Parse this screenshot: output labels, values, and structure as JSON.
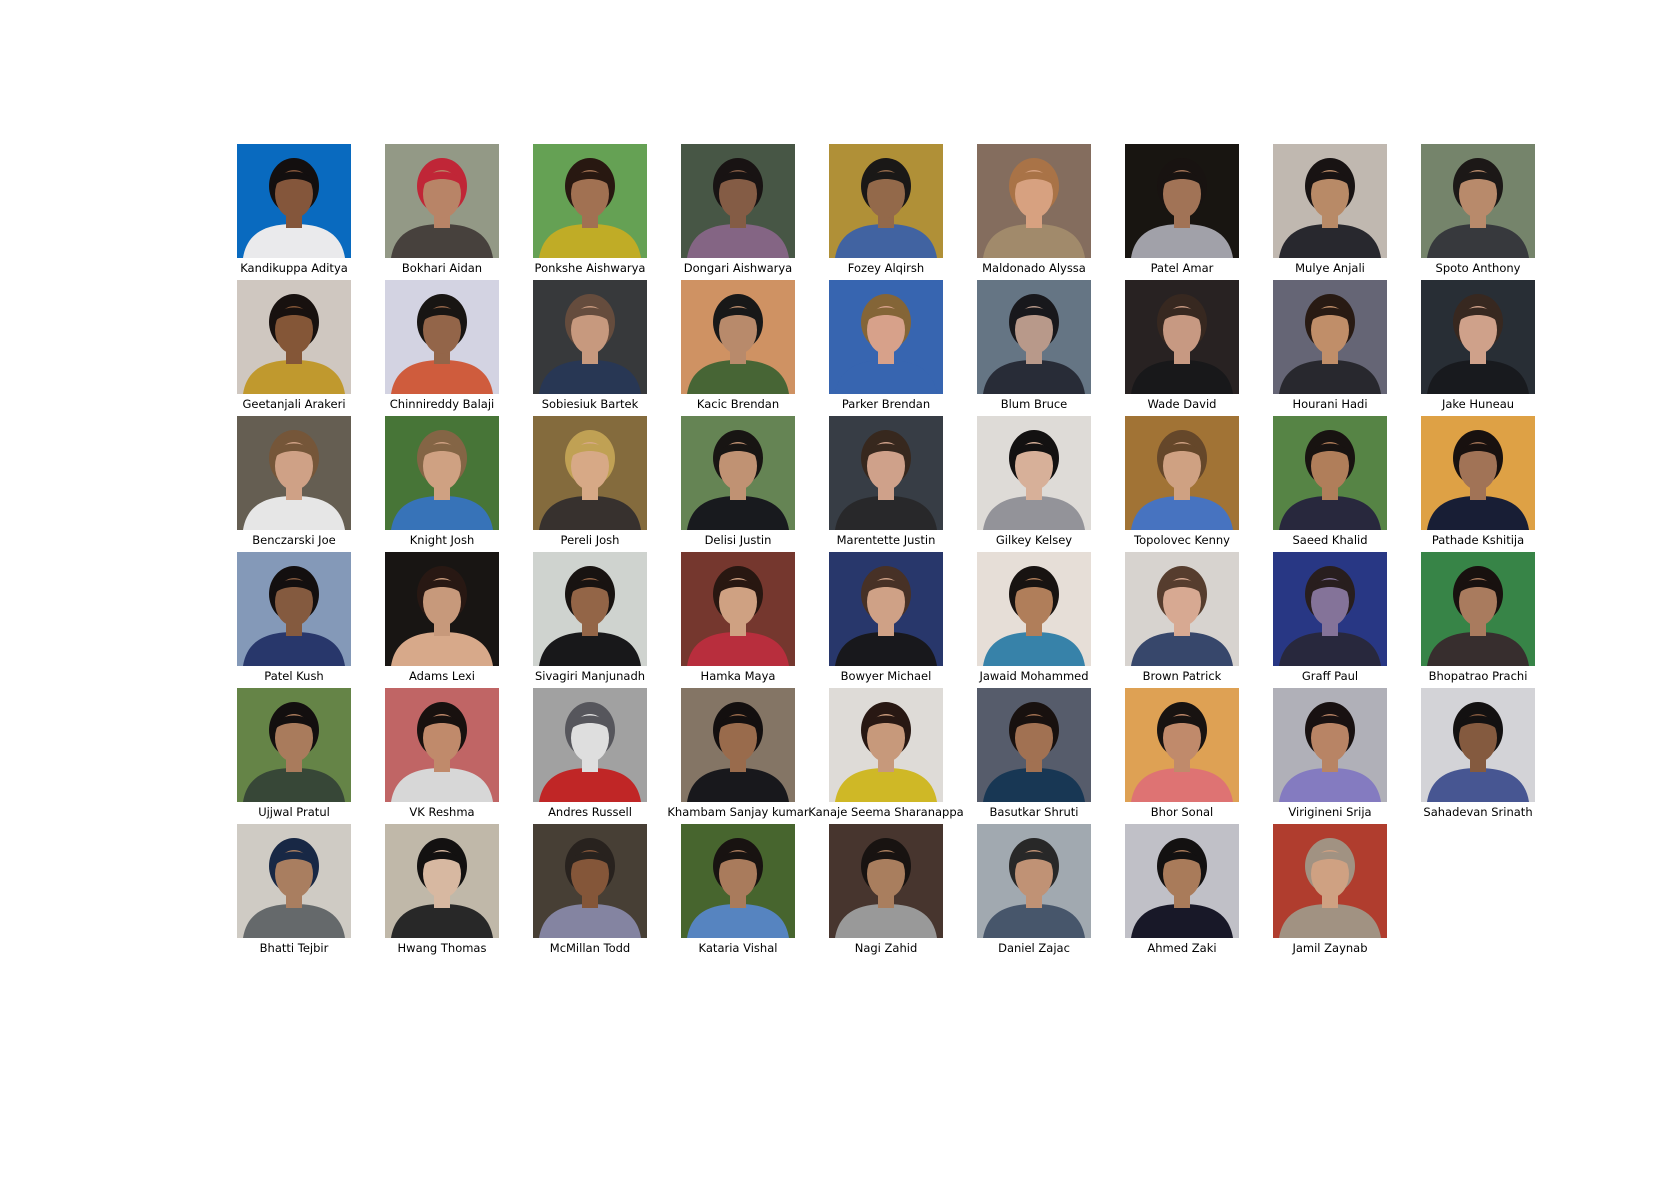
{
  "people": [
    {
      "name": "Kandikuppa Aditya",
      "bg": "#0a6fc7",
      "hair": "#141010",
      "skin": "#8a5a3e",
      "shirt": "#f4f4f6"
    },
    {
      "name": "Bokhari Aidan",
      "bg": "#9aa08c",
      "hair": "#c8283a",
      "skin": "#c08a6c",
      "shirt": "#4a4440"
    },
    {
      "name": "Ponkshe Aishwarya",
      "bg": "#6aa858",
      "hair": "#2a1a12",
      "skin": "#a87656",
      "shirt": "#c8b428"
    },
    {
      "name": "Dongari Aishwarya",
      "bg": "#4a5a48",
      "hair": "#1a1414",
      "skin": "#8a6048",
      "shirt": "#8a6a8a"
    },
    {
      "name": "Fozey Alqirsh",
      "bg": "#b8963a",
      "hair": "#1c1a18",
      "skin": "#9a6e4e",
      "shirt": "#4468a8"
    },
    {
      "name": "Maldonado Alyssa",
      "bg": "#8a7262",
      "hair": "#b0784a",
      "skin": "#e0a886",
      "shirt": "#a89070"
    },
    {
      "name": "Patel Amar",
      "bg": "#1a1612",
      "hair": "#1a1412",
      "skin": "#a8785a",
      "shirt": "#a8a8b0"
    },
    {
      "name": "Mulye Anjali",
      "bg": "#c8c0b8",
      "hair": "#1a1414",
      "skin": "#c0906c",
      "shirt": "#2a2a30"
    },
    {
      "name": "Spoto Anthony",
      "bg": "#7a8a70",
      "hair": "#1e1a18",
      "skin": "#c09070",
      "shirt": "#3a3c40"
    },
    {
      "name": "Geetanjali Arakeri",
      "bg": "#d8d0c8",
      "hair": "#1a1210",
      "skin": "#8a5a3a",
      "shirt": "#c8a030"
    },
    {
      "name": "Chinnireddy Balaji",
      "bg": "#dcdcec",
      "hair": "#1a1614",
      "skin": "#9a6a4c",
      "shirt": "#d86040"
    },
    {
      "name": "Sobiesiuk Bartek",
      "bg": "#3a3c3e",
      "hair": "#6a5040",
      "skin": "#d0a084",
      "shirt": "#2a3a58"
    },
    {
      "name": "Kacic Brendan",
      "bg": "#d89868",
      "hair": "#1a1a1a",
      "skin": "#c09070",
      "shirt": "#4a6a38"
    },
    {
      "name": "Parker Brendan",
      "bg": "#3a6ab8",
      "hair": "#8a6a3a",
      "skin": "#e0a890",
      "shirt": "#3a6ab8"
    },
    {
      "name": "Blum Bruce",
      "bg": "#6a7a8a",
      "hair": "#1a1a1e",
      "skin": "#c0a090",
      "shirt": "#2a2e3a"
    },
    {
      "name": "Wade David",
      "bg": "#2a2424",
      "hair": "#3a2a22",
      "skin": "#d0a088",
      "shirt": "#1a1a1c"
    },
    {
      "name": "Hourani Hadi",
      "bg": "#6a6a7a",
      "hair": "#2a1c14",
      "skin": "#c8946e",
      "shirt": "#2a2a30"
    },
    {
      "name": "Jake Huneau",
      "bg": "#2a3038",
      "hair": "#3a2a22",
      "skin": "#d8a890",
      "shirt": "#1a1c20"
    },
    {
      "name": "Benczarski Joe",
      "bg": "#6a6256",
      "hair": "#7a5a3c",
      "skin": "#d8a88c",
      "shirt": "#f0f0f0"
    },
    {
      "name": "Knight Josh",
      "bg": "#4a7a3a",
      "hair": "#8a6a48",
      "skin": "#d8a888",
      "shirt": "#3a78c0"
    },
    {
      "name": "Pereli Josh",
      "bg": "#8a7040",
      "hair": "#c8a858",
      "skin": "#e0b08c",
      "shirt": "#3a3430"
    },
    {
      "name": "Delisi Justin",
      "bg": "#6a8a58",
      "hair": "#1a1614",
      "skin": "#c89878",
      "shirt": "#1a1c20"
    },
    {
      "name": "Marentette Justin",
      "bg": "#3a4048",
      "hair": "#3a2a20",
      "skin": "#d8a890",
      "shirt": "#2a2a2c"
    },
    {
      "name": "Gilkey Kelsey",
      "bg": "#e8e4e0",
      "hair": "#141212",
      "skin": "#e0b8a0",
      "shirt": "#9a9aa0"
    },
    {
      "name": "Topolovec Kenny",
      "bg": "#a87838",
      "hair": "#6a4a2c",
      "skin": "#d8a888",
      "shirt": "#4a78c8"
    },
    {
      "name": "Saeed Khalid",
      "bg": "#5a8a48",
      "hair": "#1a1412",
      "skin": "#b8845e",
      "shirt": "#2a2a40"
    },
    {
      "name": "Pathade Kshitija",
      "bg": "#e8a848",
      "hair": "#1a1210",
      "skin": "#a8785a",
      "shirt": "#1a2038"
    },
    {
      "name": "Patel Kush",
      "bg": "#8aa0c0",
      "hair": "#141010",
      "skin": "#8a5e42",
      "shirt": "#2a3a70"
    },
    {
      "name": "Adams Lexi",
      "bg": "#1a1614",
      "hair": "#2a1a14",
      "skin": "#d0a080",
      "shirt": "#e0b090"
    },
    {
      "name": "Sivagiri Manjunadh",
      "bg": "#d8dcd8",
      "hair": "#1a1412",
      "skin": "#9a6a4a",
      "shirt": "#1a1a1c"
    },
    {
      "name": "Hamka Maya",
      "bg": "#7a3a30",
      "hair": "#2a1812",
      "skin": "#d8a888",
      "shirt": "#c03040"
    },
    {
      "name": "Bowyer Michael",
      "bg": "#2a3a70",
      "hair": "#4a3428",
      "skin": "#d8a88c",
      "shirt": "#1a1a1e"
    },
    {
      "name": "Jawaid Mohammed",
      "bg": "#f0e8e0",
      "hair": "#1a1412",
      "skin": "#b8845e",
      "shirt": "#3a88b0"
    },
    {
      "name": "Brown Patrick",
      "bg": "#e0dcd8",
      "hair": "#5a4030",
      "skin": "#e0b098",
      "shirt": "#3a4a70"
    },
    {
      "name": "Graff Paul",
      "bg": "#2a3a8a",
      "hair": "#2a2020",
      "skin": "#8a78a0",
      "shirt": "#2a2a40"
    },
    {
      "name": "Bhopatrao Prachi",
      "bg": "#3a8a4a",
      "hair": "#1a1210",
      "skin": "#b08062",
      "shirt": "#3a3030"
    },
    {
      "name": "Ujjwal Pratul",
      "bg": "#6a8a4a",
      "hair": "#141010",
      "skin": "#b08060",
      "shirt": "#3a4a3a"
    },
    {
      "name": "VK Reshma",
      "bg": "#c86a6a",
      "hair": "#1a1210",
      "skin": "#c89070",
      "shirt": "#e0e0e0"
    },
    {
      "name": "Andres Russell",
      "bg": "#a8a8a8",
      "hair": "#5a5a60",
      "skin": "#e8e8e8",
      "shirt": "#c82828"
    },
    {
      "name": "Khambam Sanjay kumar",
      "bg": "#8a7a6a",
      "hair": "#141010",
      "skin": "#a07050",
      "shirt": "#1a1a1e"
    },
    {
      "name": "Kanaje Seema Sharanappa",
      "bg": "#e8e4e0",
      "hair": "#2a1a14",
      "skin": "#d0a080",
      "shirt": "#d8c028"
    },
    {
      "name": "Basutkar Shruti",
      "bg": "#5a6070",
      "hair": "#1a1210",
      "skin": "#a87656",
      "shirt": "#1a3a58"
    },
    {
      "name": "Bhor Sonal",
      "bg": "#e8a858",
      "hair": "#1a1412",
      "skin": "#c89070",
      "shirt": "#e87878"
    },
    {
      "name": "Virigineni Srija",
      "bg": "#b8b8c0",
      "hair": "#1a1212",
      "skin": "#c08a6a",
      "shirt": "#8a80c8"
    },
    {
      "name": "Sahadevan Srinath",
      "bg": "#dcdce0",
      "hair": "#141212",
      "skin": "#8a5e42",
      "shirt": "#4a5a98"
    },
    {
      "name": "Bhatti Tejbir",
      "bg": "#d8d4cc",
      "hair": "#1a2a48",
      "skin": "#b08464",
      "shirt": "#6a6e70"
    },
    {
      "name": "Hwang Thomas",
      "bg": "#c8c0b0",
      "hair": "#141212",
      "skin": "#e0c0a8",
      "shirt": "#2a2a2a"
    },
    {
      "name": "McMillan Todd",
      "bg": "#4a4238",
      "hair": "#2a2420",
      "skin": "#8a5a3c",
      "shirt": "#8a8aa8"
    },
    {
      "name": "Kataria Vishal",
      "bg": "#4a6a30",
      "hair": "#1a1412",
      "skin": "#b08060",
      "shirt": "#5a8ac8"
    },
    {
      "name": "Nagi Zahid",
      "bg": "#4a3830",
      "hair": "#1a1412",
      "skin": "#b08462",
      "shirt": "#a0a0a0"
    },
    {
      "name": "Daniel Zajac",
      "bg": "#a8b0b8",
      "hair": "#2a2a2a",
      "skin": "#c8987a",
      "shirt": "#4a5a70"
    },
    {
      "name": "Ahmed Zaki",
      "bg": "#c8c8d0",
      "hair": "#141212",
      "skin": "#b0805e",
      "shirt": "#1a1a2a"
    },
    {
      "name": "Jamil Zaynab",
      "bg": "#b84030",
      "hair": "#a89888",
      "skin": "#d8a888",
      "shirt": "#a89888"
    }
  ]
}
